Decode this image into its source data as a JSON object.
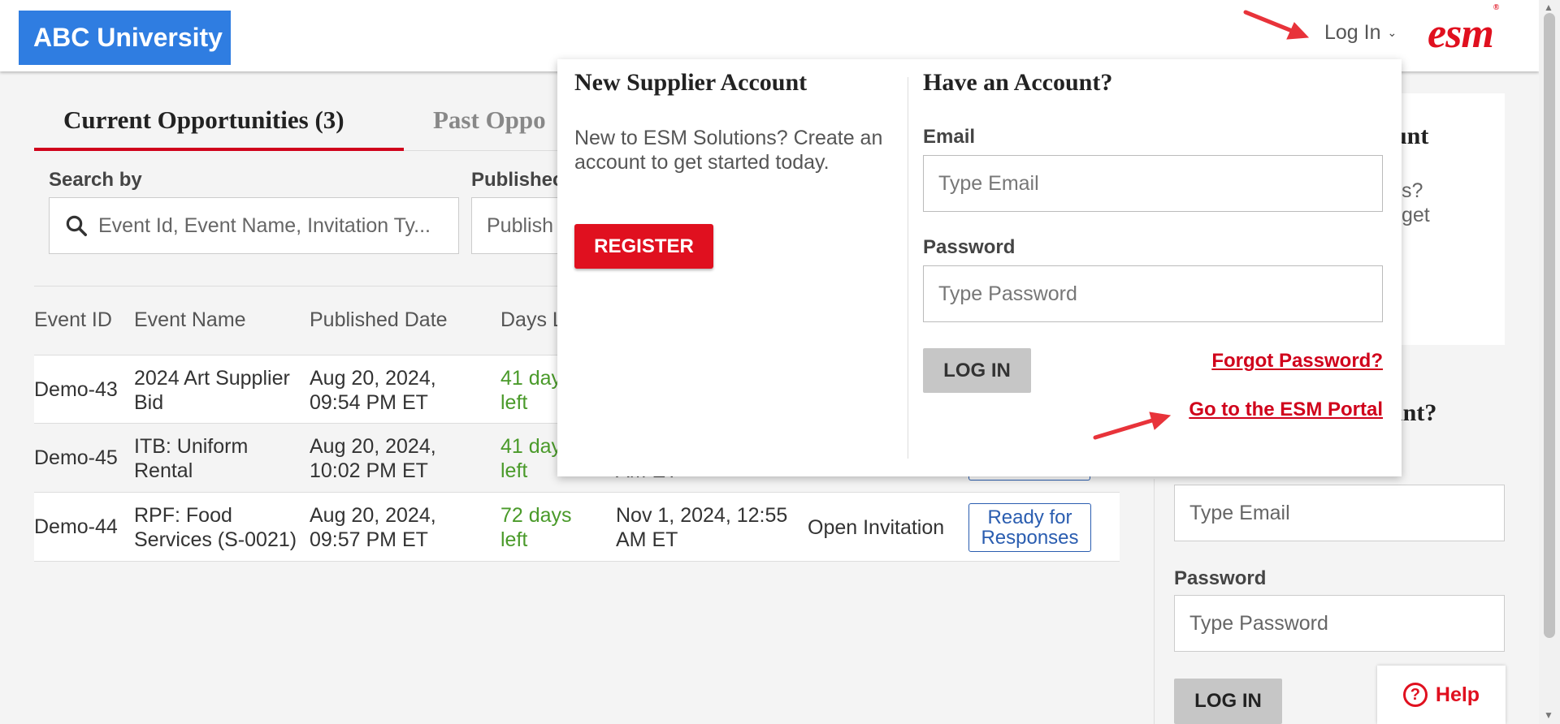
{
  "header": {
    "logo_text": "ABC University",
    "login_label": "Log In",
    "brand": "esm",
    "brand_reg": "®"
  },
  "tabs": {
    "current": "Current Opportunities (3)",
    "past": "Past Oppo"
  },
  "filters": {
    "search_label": "Search by",
    "search_placeholder": "Event Id, Event Name, Invitation Ty...",
    "published_label": "Publishec",
    "published_placeholder": "Publish"
  },
  "table": {
    "headers": [
      "Event ID",
      "Event Name",
      "Published Date",
      "Days L"
    ],
    "rows": [
      {
        "id": "Demo-43",
        "name_1": "2024 Art Supplier",
        "name_2": "Bid",
        "date_1": "Aug 20, 2024,",
        "date_2": "09:54 PM ET",
        "days_1": "41 day",
        "days_2": "left",
        "due_1": "",
        "due_2": "",
        "invitation": "",
        "status_1": "",
        "status_2": ""
      },
      {
        "id": "Demo-45",
        "name_1": "ITB: Uniform",
        "name_2": "Rental",
        "date_1": "Aug 20, 2024,",
        "date_2": "10:02 PM ET",
        "days_1": "41 day",
        "days_2": "left",
        "due_1": "",
        "due_2": "AM ET",
        "invitation": "",
        "status_1": "",
        "status_2": ""
      },
      {
        "id": "Demo-44",
        "name_1": "RPF: Food",
        "name_2": "Services (S-0021)",
        "date_1": "Aug 20, 2024,",
        "date_2": "09:57 PM ET",
        "days_1": "72 days",
        "days_2": "left",
        "due_1": "Nov 1, 2024, 12:55",
        "due_2": "AM ET",
        "invitation": "Open Invitation",
        "status_1": "Ready for",
        "status_2": "Responses"
      }
    ]
  },
  "side": {
    "heading_1": "ount",
    "text_1": "s?",
    "text_2": "get",
    "heading_2": "ount?",
    "email_placeholder": "Type Email",
    "password_label": "Password",
    "password_placeholder": "Type Password",
    "login_button": "LOG IN",
    "help_label": "Help",
    "help_icon_glyph": "?"
  },
  "popup": {
    "new_title": "New Supplier Account",
    "new_desc": "New to ESM Solutions? Create an account to get started today.",
    "register_button": "REGISTER",
    "have_title": "Have an Account?",
    "email_label": "Email",
    "email_placeholder": "Type Email",
    "password_label": "Password",
    "password_placeholder": "Type Password",
    "login_button": "LOG IN",
    "forgot_link": "Forgot Password?",
    "portal_link": "Go to the ESM Portal"
  },
  "colors": {
    "accent_red": "#e0101f",
    "logo_blue": "#2f7de1",
    "days_green": "#4a9a2a",
    "annotation_arrow": "#e8333a"
  }
}
